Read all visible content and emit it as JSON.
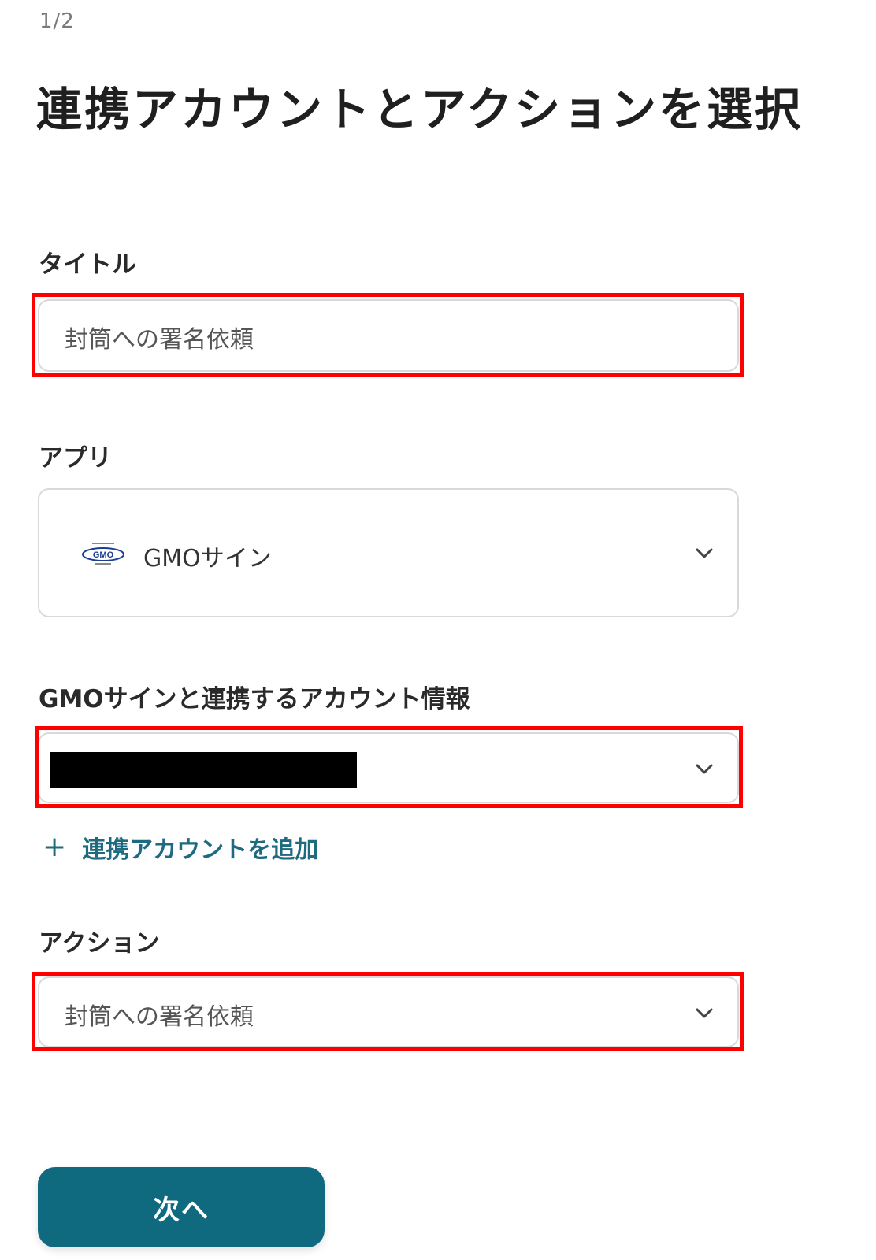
{
  "header": {
    "step": "1/2",
    "title": "連携アカウントとアクションを選択"
  },
  "form": {
    "title_field": {
      "label": "タイトル",
      "value": "封筒への署名依頼"
    },
    "app_field": {
      "label": "アプリ",
      "value": "GMOサイン",
      "logo_icon": "gmo-sign-logo-icon"
    },
    "account_field": {
      "label": "GMOサインと連携するアカウント情報",
      "value": "",
      "add_link": "連携アカウントを追加"
    },
    "action_field": {
      "label": "アクション",
      "value": "封筒への署名依頼"
    }
  },
  "footer": {
    "next_label": "次へ"
  },
  "colors": {
    "accent": "#0f6a80",
    "link": "#1e6a80",
    "highlight": "#ff0000",
    "border": "#d9d9d9"
  }
}
